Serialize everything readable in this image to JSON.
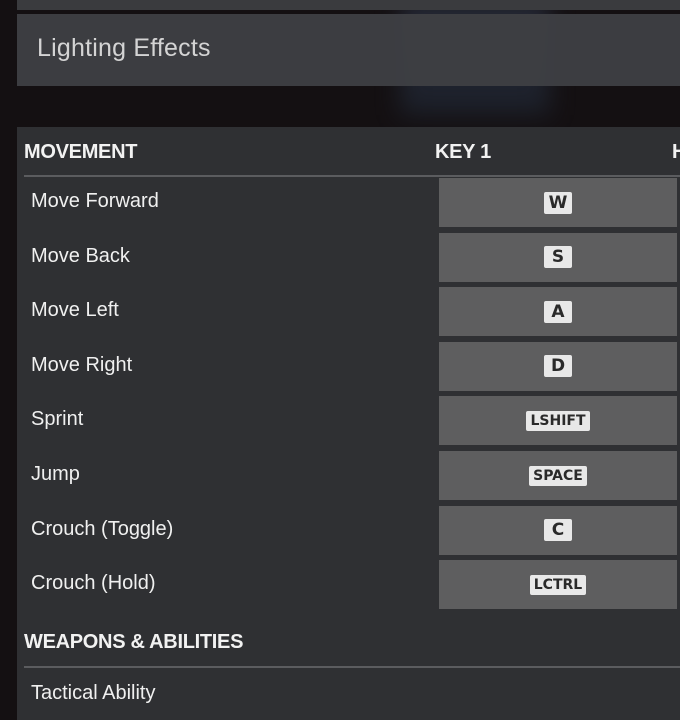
{
  "lighting": {
    "label": "Lighting Effects"
  },
  "headers": {
    "section1": "MOVEMENT",
    "key1": "KEY 1",
    "key2_partial": "H",
    "section2": "WEAPONS & ABILITIES"
  },
  "movement": [
    {
      "action": "Move Forward",
      "key": "W"
    },
    {
      "action": "Move Back",
      "key": "S"
    },
    {
      "action": "Move Left",
      "key": "A"
    },
    {
      "action": "Move Right",
      "key": "D"
    },
    {
      "action": "Sprint",
      "key": "LSHIFT"
    },
    {
      "action": "Jump",
      "key": "SPACE"
    },
    {
      "action": "Crouch (Toggle)",
      "key": "C"
    },
    {
      "action": "Crouch (Hold)",
      "key": "LCTRL"
    }
  ],
  "weapons": [
    {
      "action": "Tactical Ability"
    }
  ]
}
